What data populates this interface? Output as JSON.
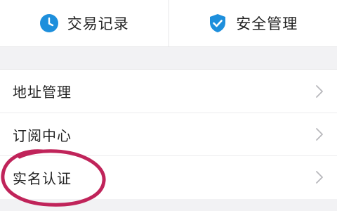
{
  "top_actions": [
    {
      "label": "交易记录",
      "icon": "clock-icon",
      "icon_color": "#1e8fdc"
    },
    {
      "label": "安全管理",
      "icon": "shield-check-icon",
      "icon_color": "#1e8fdc"
    }
  ],
  "list": {
    "items": [
      {
        "label": "地址管理"
      },
      {
        "label": "订阅中心"
      },
      {
        "label": "实名认证"
      }
    ]
  },
  "colors": {
    "accent": "#1e8fdc",
    "annotation": "#c0245a",
    "background": "#f2f2f4"
  }
}
